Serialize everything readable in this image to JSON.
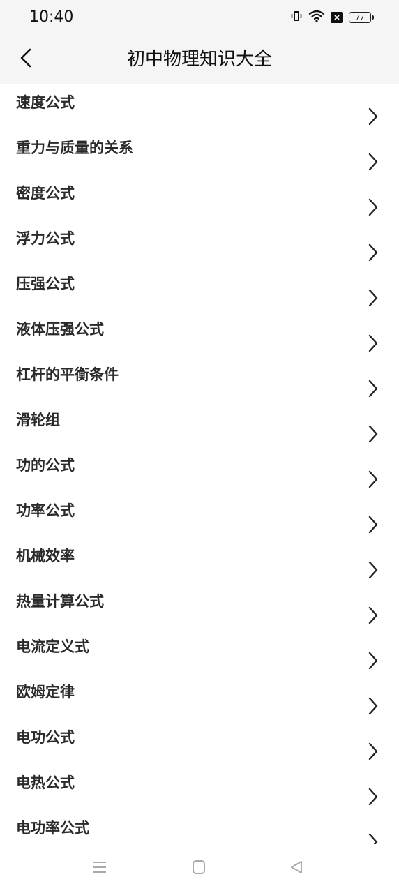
{
  "status_bar": {
    "time": "10:40",
    "battery": "77",
    "icons": [
      "vibrate-icon",
      "wifi-icon",
      "close-box-icon",
      "battery-icon"
    ]
  },
  "header": {
    "title": "初中物理知识大全",
    "back_icon": "chevron-left-icon"
  },
  "list": {
    "items": [
      {
        "label": "速度公式"
      },
      {
        "label": "重力与质量的关系"
      },
      {
        "label": "密度公式"
      },
      {
        "label": "浮力公式"
      },
      {
        "label": "压强公式"
      },
      {
        "label": "液体压强公式"
      },
      {
        "label": "杠杆的平衡条件"
      },
      {
        "label": "滑轮组"
      },
      {
        "label": "功的公式"
      },
      {
        "label": "功率公式"
      },
      {
        "label": "机械效率"
      },
      {
        "label": "热量计算公式"
      },
      {
        "label": "电流定义式"
      },
      {
        "label": "欧姆定律"
      },
      {
        "label": "电功公式"
      },
      {
        "label": "电热公式"
      },
      {
        "label": "电功率公式"
      }
    ],
    "item_icon": "chevron-right-icon"
  },
  "nav_bar": {
    "buttons": [
      "menu-icon",
      "home-icon",
      "back-triangle-icon"
    ]
  },
  "colors": {
    "header_bg": "#f5f5f5",
    "text": "#2a2a2a",
    "icon": "#222222",
    "nav_icon": "#aaaaaa"
  }
}
